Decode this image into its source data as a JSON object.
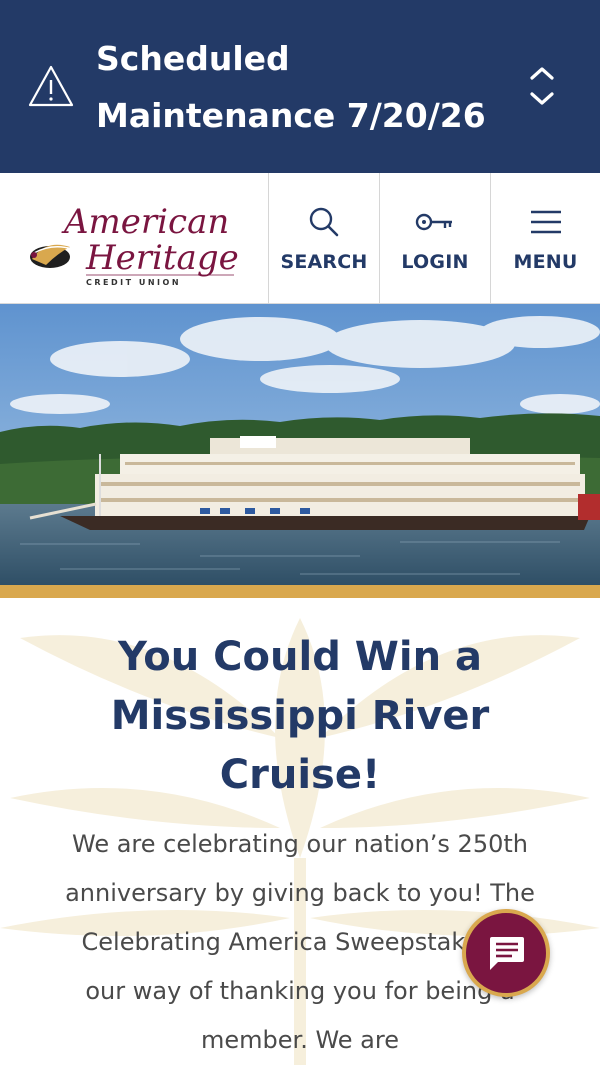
{
  "alert": {
    "icon": "warning-triangle-icon",
    "title": "Scheduled Maintenance 7/20/26",
    "toggle_icon": "chevron-up-down-icon"
  },
  "header": {
    "logo": {
      "line1": "American",
      "line2": "Heritage",
      "line3": "CREDIT UNION"
    },
    "nav": {
      "search": "SEARCH",
      "login": "LOGIN",
      "menu": "MENU"
    }
  },
  "hero": {
    "image": "riverboat-on-mississippi-river-photo"
  },
  "promo": {
    "title": "You Could Win a Mississippi River Cruise!",
    "body": "We are celebrating our nation’s 250th anniversary by giving back to you! The Celebrating America Sweepstakes is our way of thanking you for being a member. We are"
  },
  "chat": {
    "icon": "chat-bubble-icon"
  },
  "colors": {
    "navy": "#233a67",
    "gold": "#d9a84e",
    "maroon": "#7a1540"
  }
}
